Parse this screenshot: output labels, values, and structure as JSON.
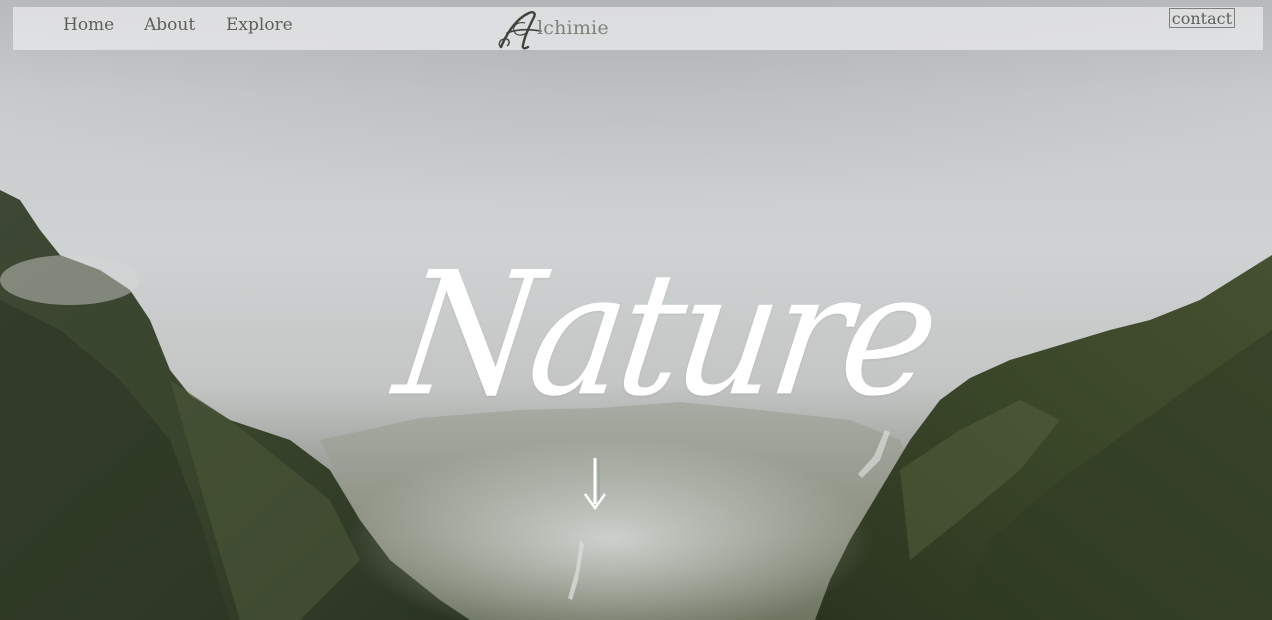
{
  "nav": {
    "home_label": "Home",
    "about_label": "About",
    "explore_label": "Explore",
    "contact_label": "contact"
  },
  "brand": {
    "name": "lchimie",
    "logo_icon": "ornate-letter-a-icon"
  },
  "hero": {
    "title": "Nature",
    "scroll_icon": "down-arrow-icon",
    "background_icon": "mountain-valley-fog-image"
  },
  "colors": {
    "nav_background": "#ebecee",
    "nav_text": "#5c6058",
    "brand_text": "#7d827a",
    "title_text": "#ffffff",
    "sky": "#cfd2d3",
    "mountain_dark": "#2f3a28"
  }
}
